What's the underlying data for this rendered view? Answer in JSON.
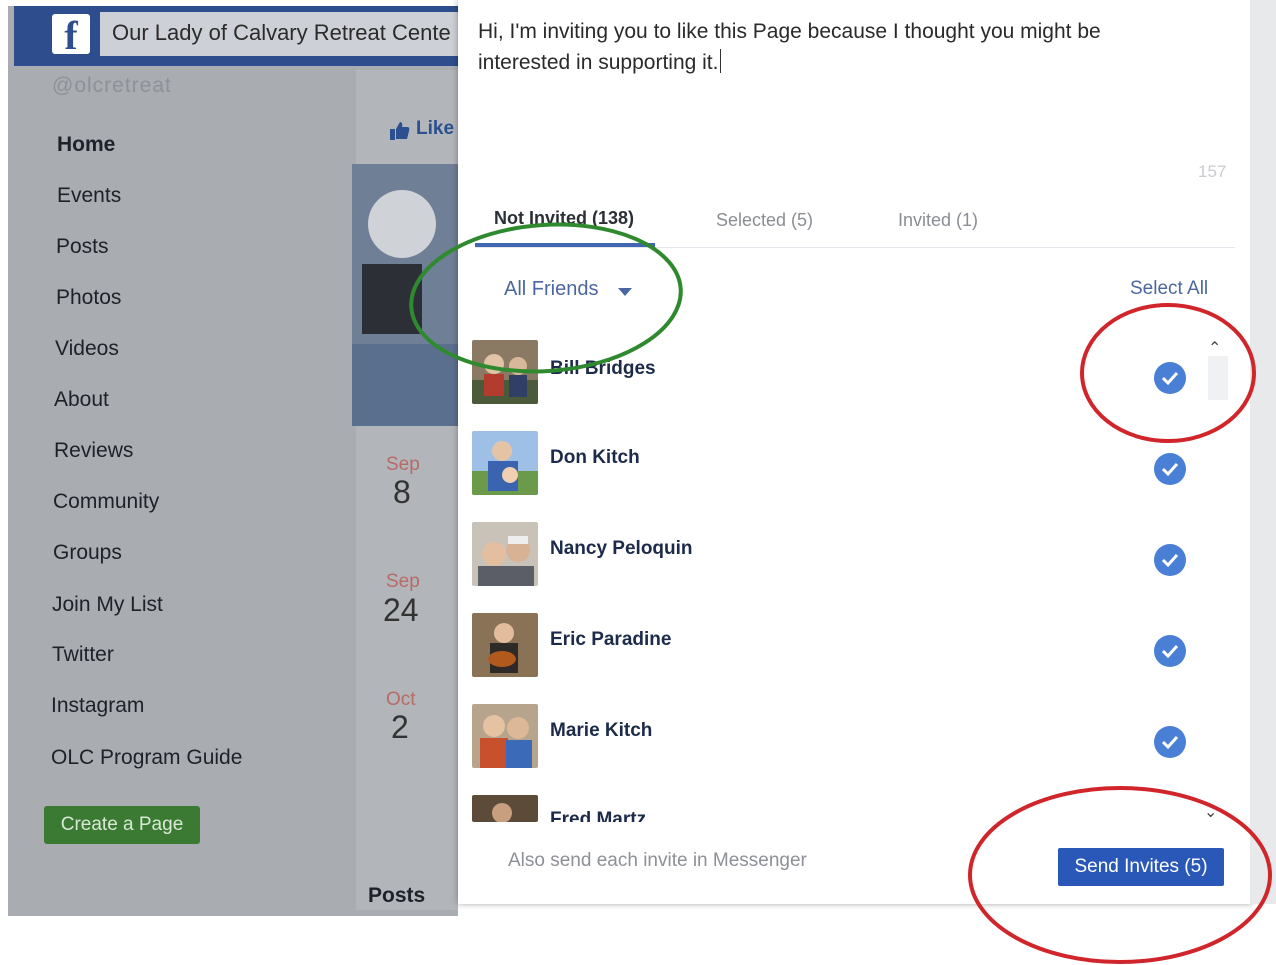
{
  "background_page": {
    "page_title": "Our Lady of Calvary Retreat Cente",
    "handle": "@olcretreat",
    "logo_letter": "f",
    "nav_items": [
      {
        "label": "Home",
        "active": true
      },
      {
        "label": "Events"
      },
      {
        "label": "Posts"
      },
      {
        "label": "Photos"
      },
      {
        "label": "Videos"
      },
      {
        "label": "About"
      },
      {
        "label": "Reviews"
      },
      {
        "label": "Community"
      },
      {
        "label": "Groups"
      },
      {
        "label": "Join My List"
      },
      {
        "label": "Twitter"
      },
      {
        "label": "Instagram"
      },
      {
        "label": "OLC Program Guide"
      }
    ],
    "create_page_label": "Create a Page",
    "like_label": "Like",
    "events": [
      {
        "month": "Sep",
        "day": "8"
      },
      {
        "month": "Sep",
        "day": "24"
      },
      {
        "month": "Oct",
        "day": "2"
      }
    ],
    "posts_heading": "Posts"
  },
  "dialog": {
    "message": "Hi, I'm inviting you to like this Page because I thought you might be interested in supporting it.",
    "char_count": "157",
    "tabs": [
      {
        "label": "Not Invited (138)",
        "active": true
      },
      {
        "label": "Selected (5)"
      },
      {
        "label": "Invited (1)"
      }
    ],
    "filter_label": "All Friends",
    "select_all_label": "Select All",
    "friends": [
      {
        "name": "Bill Bridges",
        "selected": true
      },
      {
        "name": "Don Kitch",
        "selected": true
      },
      {
        "name": "Nancy Peloquin",
        "selected": true
      },
      {
        "name": "Eric Paradine",
        "selected": true
      },
      {
        "name": "Marie Kitch",
        "selected": true
      },
      {
        "name": "Fred Martz",
        "selected": false
      }
    ],
    "messenger_option": "Also send each invite in Messenger",
    "send_button_label": "Send Invites (5)"
  },
  "colors": {
    "facebook_blue": "#2e4d8c",
    "button_blue": "#2a58b9",
    "check_blue": "#4a7fd6",
    "annotation_green": "#2f8a2f",
    "annotation_red": "#d0262b"
  }
}
